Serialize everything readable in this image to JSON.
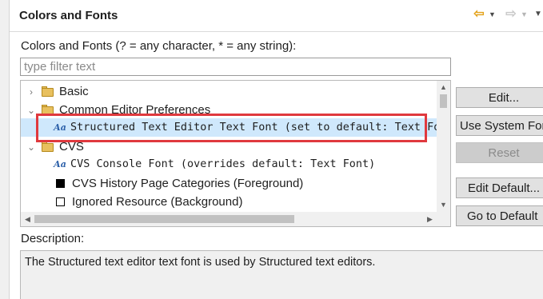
{
  "header": {
    "title": "Colors and Fonts",
    "back_icon": "arrow-left-icon",
    "forward_icon": "arrow-right-icon"
  },
  "section_label": "Colors and Fonts (? = any character, * = any string):",
  "filter": {
    "value": "",
    "placeholder": "type filter text"
  },
  "tree": {
    "items": [
      {
        "kind": "category",
        "expanded": false,
        "label": "Basic"
      },
      {
        "kind": "category",
        "expanded": true,
        "label": "Common Editor Preferences"
      },
      {
        "kind": "font",
        "label": "Structured Text Editor Text Font (set to default: Text Font)",
        "selected": true
      },
      {
        "kind": "category",
        "expanded": true,
        "label": "CVS"
      },
      {
        "kind": "font",
        "label": "CVS Console Font (overrides default: Text Font)"
      },
      {
        "kind": "color",
        "label": "CVS History Page Categories (Foreground)",
        "color": "#000000"
      },
      {
        "kind": "color",
        "label": "Ignored Resource (Background)",
        "color": "#ffffff"
      }
    ]
  },
  "buttons": {
    "edit": "Edit...",
    "use_system_font": "Use System Font",
    "reset": "Reset",
    "edit_default": "Edit Default...",
    "go_to_default": "Go to Default"
  },
  "description": {
    "label": "Description:",
    "text": "The Structured text editor text font is used by Structured text editors."
  },
  "colors": {
    "selection": "#cfe8fc",
    "highlight_border": "#e0393e",
    "folder": "#e8c05e",
    "font_icon": "#2b5fa8"
  }
}
